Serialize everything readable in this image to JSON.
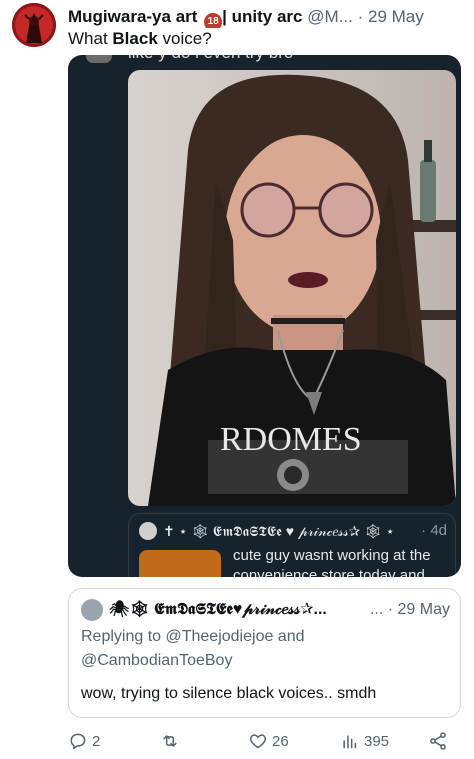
{
  "tweet": {
    "display_name": "Mugiwara-ya art",
    "age_badge": "18",
    "name_suffix": "| unity arc",
    "handle": "@M...",
    "separator": "·",
    "date": "29 May",
    "text_prefix": "What ",
    "text_bold": "Black",
    "text_suffix": " voice?"
  },
  "quoted_dark": {
    "cut_off_text": "like y do i even try bro",
    "inner_quote": {
      "name": "✝ ⋆ 🕸 𝕰𝖒𝕯𝖆𝕾𝕿𝕰𝖊 ♥ 𝓅𝓇𝒾𝓃𝒸𝑒𝓈𝓈✰ 🕸 ⋆",
      "separator": "·",
      "date": "4d",
      "text": "cute guy wasnt working at the convenience store today and"
    }
  },
  "reply_card": {
    "name": "🕷🕸 𝕰𝖒𝕯𝖆𝕾𝕿𝕰𝖊♥𝓅𝓇𝒾𝓃𝒸𝑒𝓈𝓈✰...",
    "dots": "...",
    "separator": "·",
    "date": "29 May",
    "replying_line1": "Replying to @Theejodiejoe and",
    "replying_line2": "@CambodianToeBoy",
    "text": "wow, trying to silence black voices.. smdh"
  },
  "actions": {
    "replies": "2",
    "reposts": "",
    "likes": "26",
    "views": "395"
  },
  "colors": {
    "dark_card_bg": "#16222c",
    "secondary_text": "#536471",
    "badge_red": "#c0392b"
  }
}
